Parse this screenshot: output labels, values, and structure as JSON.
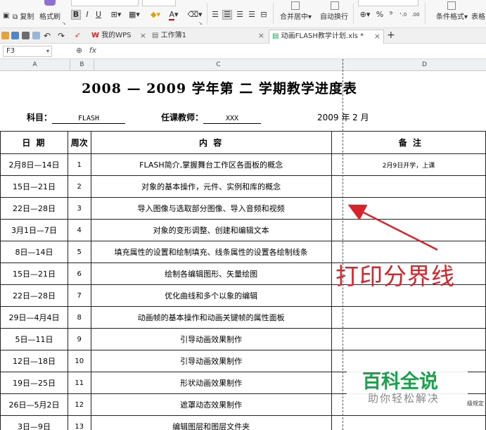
{
  "ribbon": {
    "copy_label": "复制",
    "format_painter_label": "格式刷",
    "bold": "B",
    "italic": "I",
    "underline": "U",
    "font_color_glyph": "A",
    "merge_center_label": "合并居中",
    "wrap_text_label": "自动换行",
    "percent": "%",
    "conditional_format_label": "条件格式",
    "table_style_label": "表格"
  },
  "tabs": [
    {
      "label": "我的WPS",
      "close": "×"
    },
    {
      "label": "工作簿1",
      "close": "×"
    },
    {
      "label": "动画FLASH教学计划.xls *",
      "close": "×"
    }
  ],
  "new_tab": "+",
  "formula_bar": {
    "cell_ref": "F3",
    "fx": "fx",
    "value": ""
  },
  "columns": [
    "A",
    "B",
    "C",
    "D"
  ],
  "sheet": {
    "title": "2008 — 2009 学年第 二 学期教学进度表",
    "subject_label": "科目：",
    "subject_value": "FLASH",
    "teacher_label": "任课教师：",
    "teacher_value": "XXX",
    "date_text": "2009 年 2 月",
    "headers": {
      "date": "日  期",
      "week": "周次",
      "content": "内        容",
      "note": "备  注"
    },
    "rows": [
      {
        "date": "2月8日—14日",
        "week": "1",
        "content": "FLASH简介,掌握舞台工作区各面板的概念",
        "note": "2月9日开学，上课"
      },
      {
        "date": "15日—21日",
        "week": "2",
        "content": "对象的基本操作，元件、实例和库的概念",
        "note": ""
      },
      {
        "date": "22日—28日",
        "week": "3",
        "content": "导入图像与选取部分图像、导入音频和视频",
        "note": ""
      },
      {
        "date": "3月1日—7日",
        "week": "4",
        "content": "对象的变形调整、创建和编辑文本",
        "note": ""
      },
      {
        "date": "8日—14日",
        "week": "5",
        "content": "填充属性的设置和绘制填充、线条属性的设置各绘制线条",
        "note": ""
      },
      {
        "date": "15日—21日",
        "week": "6",
        "content": "绘制各编辑图形、矢量绘图",
        "note": ""
      },
      {
        "date": "22日—28日",
        "week": "7",
        "content": "优化曲线和多个以象的编辑",
        "note": ""
      },
      {
        "date": "29日—4月4日",
        "week": "8",
        "content": "动画帧的基本操作和动画关键帧的属性面板",
        "note": ""
      },
      {
        "date": "5日—11日",
        "week": "9",
        "content": "引导动画效果制作",
        "note": ""
      },
      {
        "date": "12日—18日",
        "week": "10",
        "content": "引导动画效果制作",
        "note": ""
      },
      {
        "date": "19日—25日",
        "week": "11",
        "content": "形状动画效果制作",
        "note": ""
      },
      {
        "date": "26日—5月2日",
        "week": "12",
        "content": "遮罩动态效果制作",
        "note": ""
      },
      {
        "date": "3日—9日",
        "week": "13",
        "content": "编辑图层和图层文件夹",
        "note": ""
      }
    ]
  },
  "annotation": {
    "text": "打印分界线",
    "color": "#d9232a"
  },
  "watermark": {
    "title": "百科全说",
    "subtitle": "助你轻松解决",
    "title_color": "#16a34a"
  },
  "clipped_side_text": "级规定"
}
